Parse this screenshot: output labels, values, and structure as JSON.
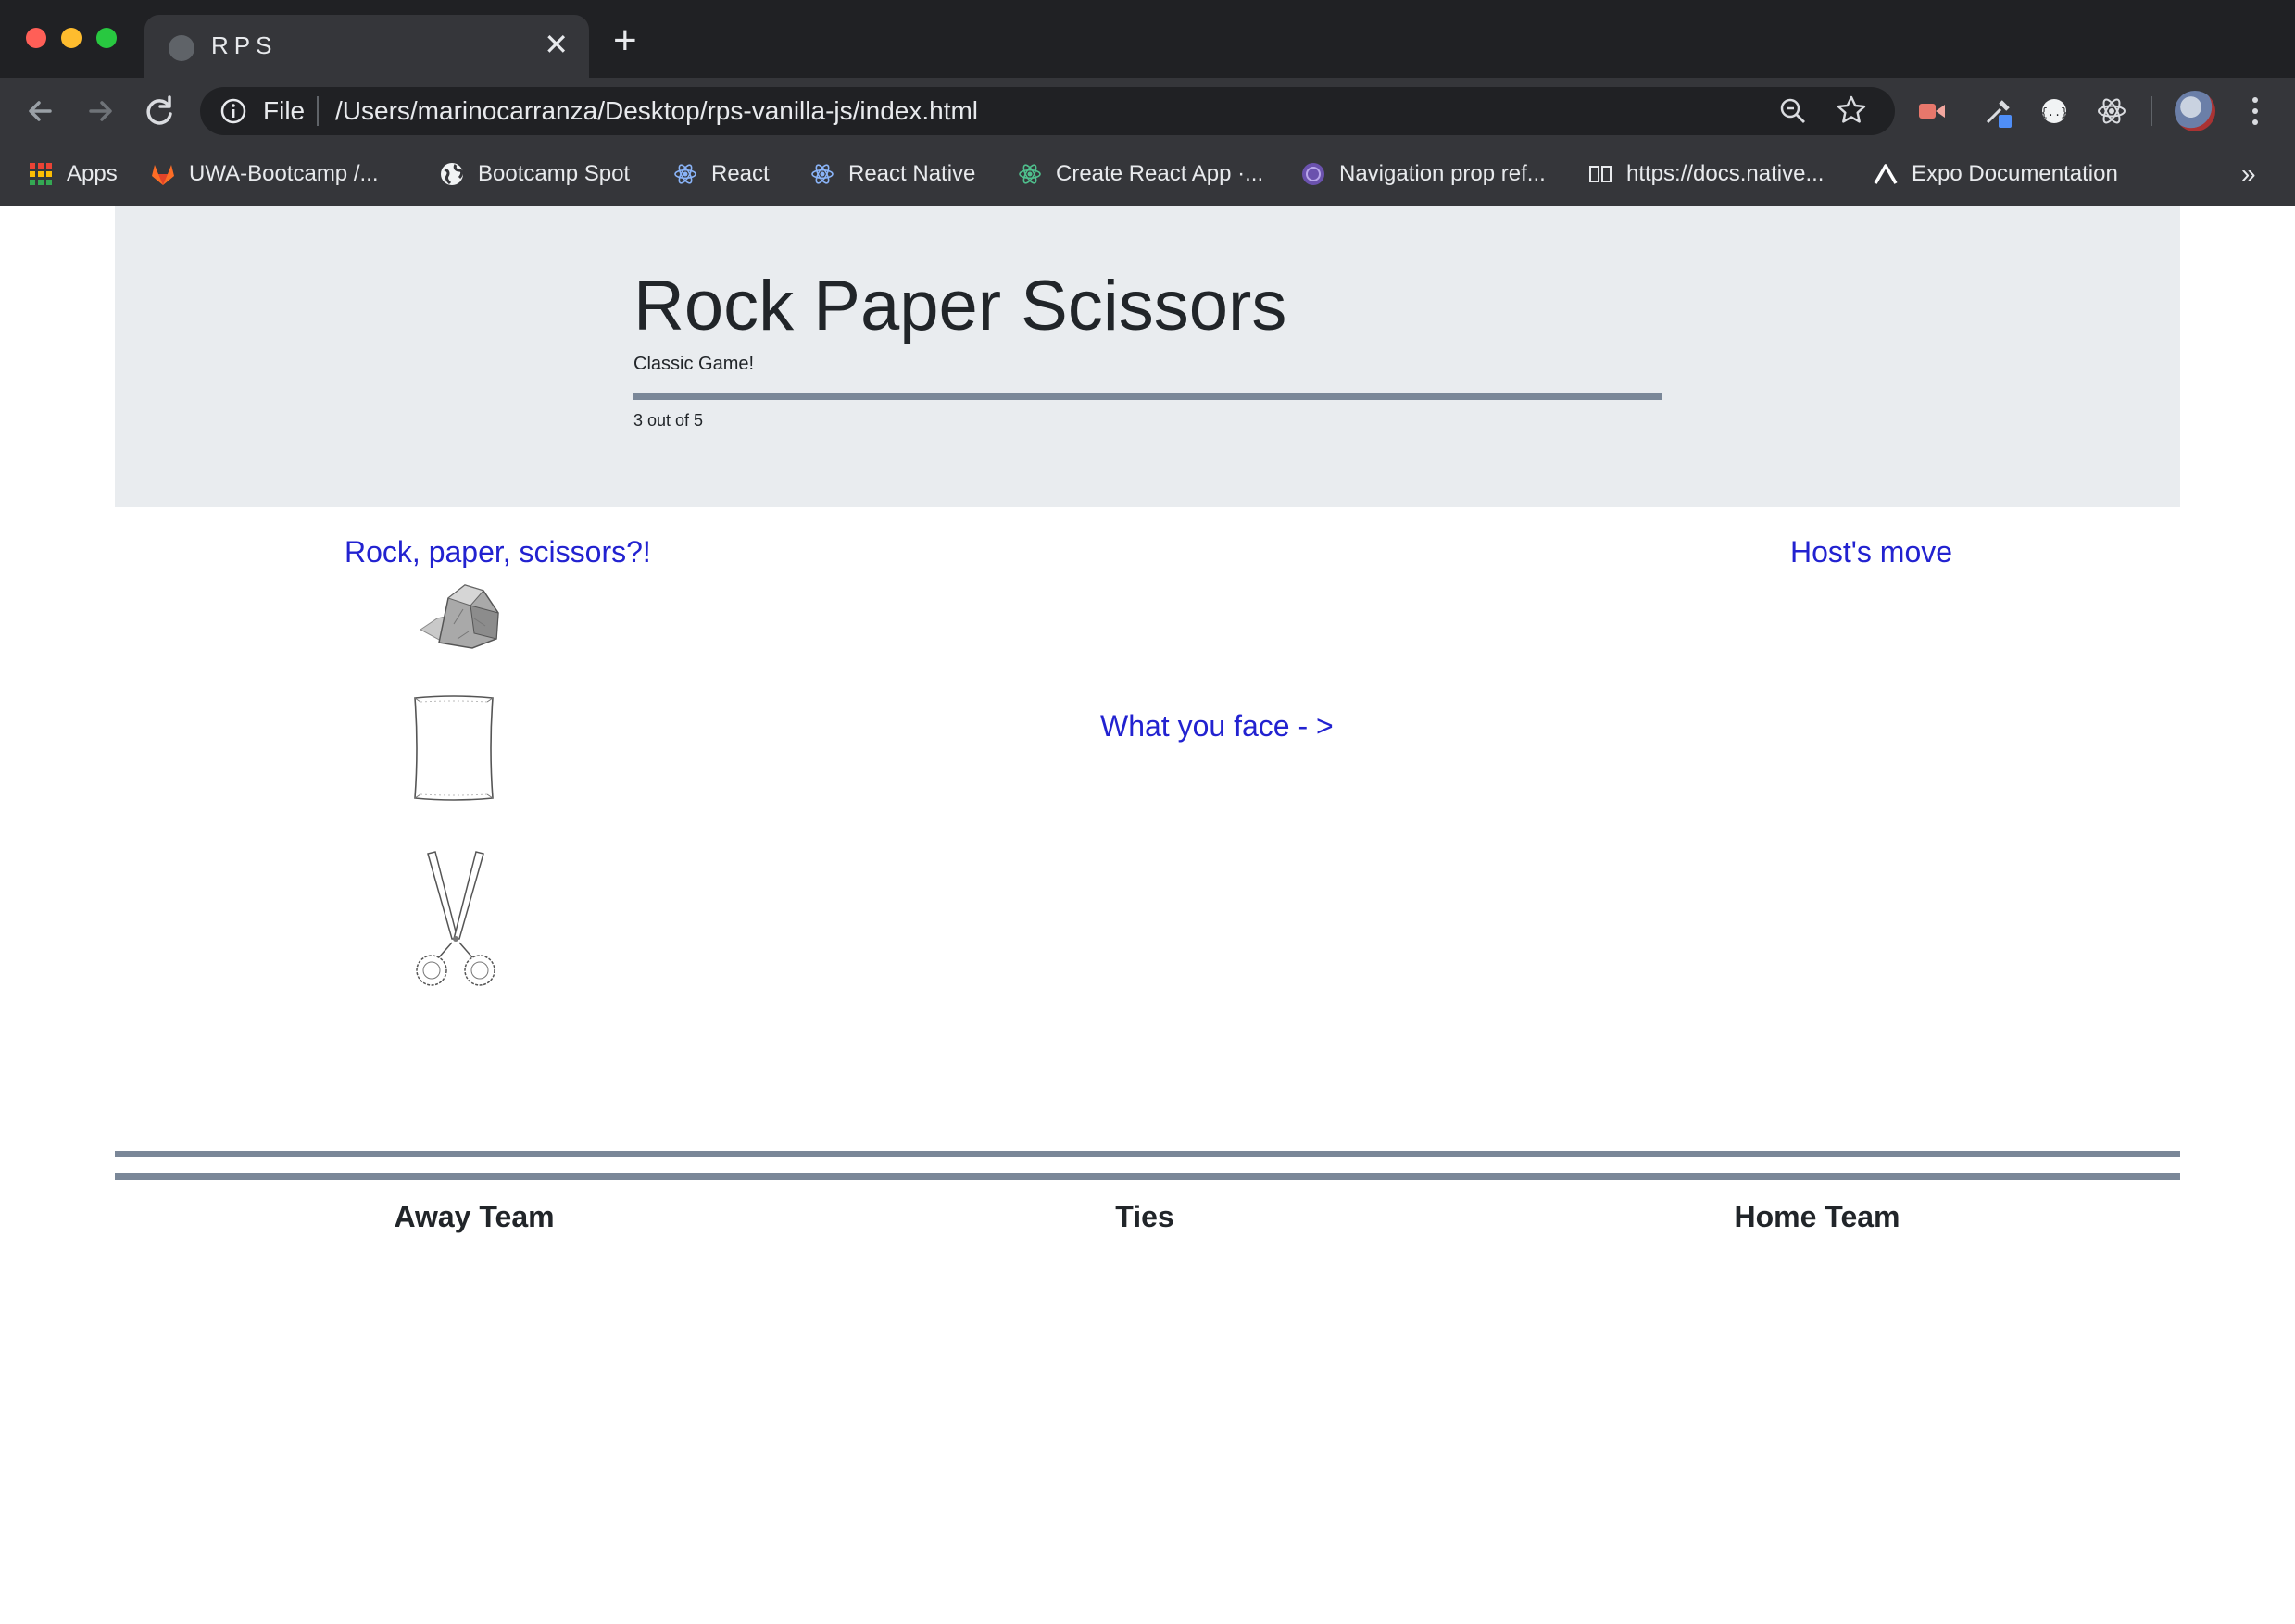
{
  "browser": {
    "tab_title": "RPS",
    "file_label": "File",
    "url": "/Users/marinocarranza/Desktop/rps-vanilla-js/index.html",
    "new_tab": "+",
    "close_tab": "✕",
    "bookmarks": [
      {
        "label": "Apps",
        "icon": "apps-grid-icon"
      },
      {
        "label": "UWA-Bootcamp /...",
        "icon": "gitlab-icon"
      },
      {
        "label": "Bootcamp Spot",
        "icon": "globe-icon"
      },
      {
        "label": "React",
        "icon": "react-icon"
      },
      {
        "label": "React Native",
        "icon": "react-icon"
      },
      {
        "label": "Create React App ·...",
        "icon": "react-icon"
      },
      {
        "label": "Navigation prop ref...",
        "icon": "react-navigation-icon"
      },
      {
        "label": "https://docs.native...",
        "icon": "docs-icon"
      },
      {
        "label": "Expo Documentation",
        "icon": "expo-icon"
      }
    ],
    "bookmarks_more": "»"
  },
  "header": {
    "title": "Rock Paper Scissors",
    "subtitle": "Classic Game!",
    "round_text": "3 out of 5"
  },
  "game": {
    "choose_label": "Rock, paper, scissors?!",
    "host_label": "Host's move",
    "face_label": "What you face - >",
    "choices": [
      {
        "name": "rock",
        "icon": "rock-icon"
      },
      {
        "name": "paper",
        "icon": "paper-icon"
      },
      {
        "name": "scissors",
        "icon": "scissors-icon"
      }
    ]
  },
  "scoreboard": {
    "away_label": "Away Team",
    "ties_label": "Ties",
    "home_label": "Home Team"
  },
  "colors": {
    "accent_link": "#2222d0",
    "jumbotron_bg": "#e9ecef",
    "rule": "#7a8798"
  }
}
